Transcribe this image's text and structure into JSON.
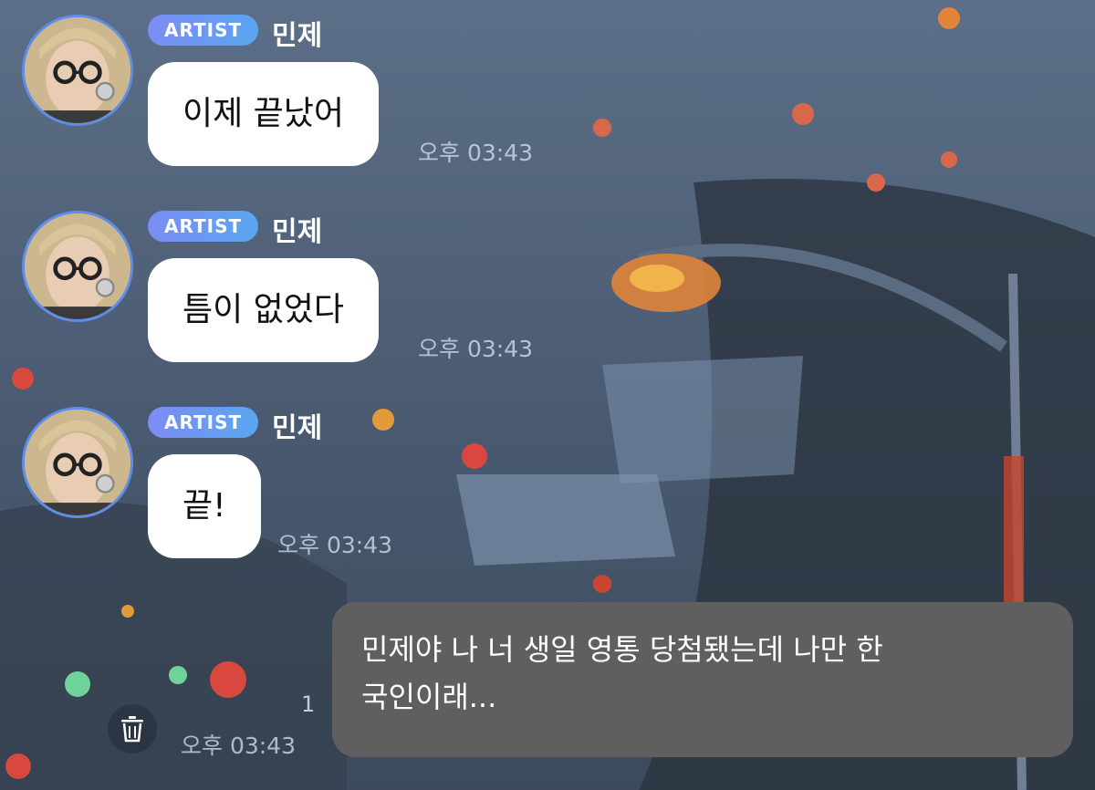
{
  "messages": [
    {
      "badge": "ARTIST",
      "sender": "민제",
      "text": "이제 끝났어",
      "time": "오후 03:43"
    },
    {
      "badge": "ARTIST",
      "sender": "민제",
      "text": "틈이 없었다",
      "time": "오후 03:43"
    },
    {
      "badge": "ARTIST",
      "sender": "민제",
      "text": "끝!",
      "time": "오후 03:43"
    }
  ],
  "my_message": {
    "line1": "민제야 나 너 생일 영통 당첨됐는데 나만 한",
    "line2": "국인이래...",
    "time": "오후 03:43",
    "unread_count": "1"
  },
  "icons": {
    "delete": "trash-icon",
    "avatar": "avatar-photo"
  },
  "colors": {
    "badge_start": "#7c8cf4",
    "badge_end": "#5aa6f0",
    "avatar_ring": "#5f8ee6",
    "my_bubble": "#5f5f5f"
  }
}
